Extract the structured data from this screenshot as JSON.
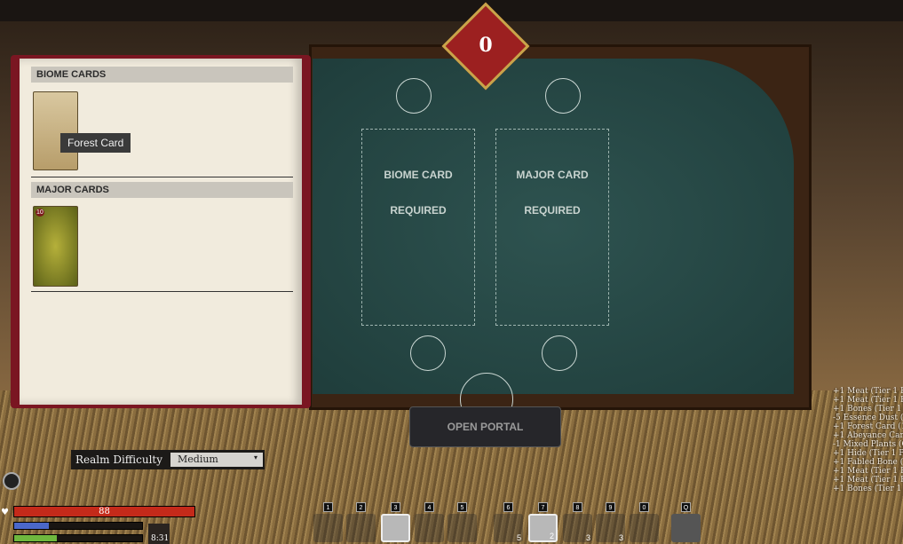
{
  "counter": "0",
  "book": {
    "biome_header": "BIOME CARDS",
    "major_header": "MAJOR CARDS",
    "tooltip": "Forest Card",
    "major_card_level": "10"
  },
  "board": {
    "slot1": [
      "BIOME CARD",
      "REQUIRED"
    ],
    "slot2": [
      "MAJOR CARD",
      "REQUIRED"
    ]
  },
  "open_portal": "OPEN PORTAL",
  "difficulty": {
    "label": "Realm Difficulty",
    "value": "Medium"
  },
  "stats": {
    "health": "88",
    "health_pct": 1.0,
    "mana_pct": 0.27,
    "stamina_pct": 0.33,
    "time": "8:31"
  },
  "hotbar": [
    {
      "key": "1"
    },
    {
      "key": "2"
    },
    {
      "key": "3",
      "selected": true
    },
    {
      "key": "4"
    },
    {
      "key": "5"
    },
    {
      "key": "6",
      "count": "5"
    },
    {
      "key": "7",
      "count": "2",
      "selected": true
    },
    {
      "key": "8",
      "count": "3"
    },
    {
      "key": "9",
      "count": "3"
    },
    {
      "key": "0"
    },
    {
      "key": "Q"
    }
  ],
  "log": [
    "+1 Meat (Tier 1 Pred",
    "+1 Meat (Tier 1 Pred",
    "+1 Bones (Tier 1 Pr",
    "-5 Essence Dust (39)",
    "+1 Forest Card (1)",
    "+1 Abeyance Card (1",
    "-1 Mixed Plants (Cap",
    "+1 Hide (Tier 1 Pred",
    "+1 Fabled Bone (Tie",
    "+1 Meat (Tier 1 Pred",
    "+1 Meat (Tier 1 Pred",
    "+1 Bones (Tier 1 Pr"
  ]
}
